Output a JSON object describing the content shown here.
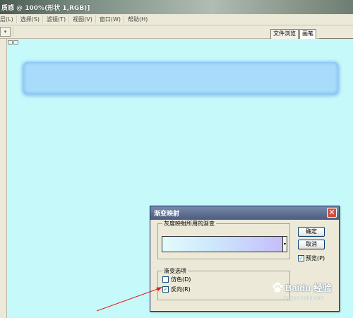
{
  "window": {
    "title": "质感 @ 100%(形状 1,RGB)]"
  },
  "menu": {
    "items": [
      "层(L)",
      "选择(S)",
      "滤镜(T)",
      "视图(V)",
      "窗口(W)",
      "帮助(H)"
    ]
  },
  "panel_tabs": [
    "文件浏览",
    "画笔"
  ],
  "dialog": {
    "title": "渐变映射",
    "group_gradient_label": "灰度映射所用的渐变",
    "ok_label": "确定",
    "cancel_label": "取消",
    "preview_label": "预览(P)",
    "preview_checked": true,
    "group_options_label": "渐变选项",
    "dither_label": "仿色(D)",
    "dither_checked": false,
    "reverse_label": "反向(R)",
    "reverse_checked": true,
    "close_glyph": "✕"
  },
  "colors": {
    "canvas": "#c6fafa",
    "shape_fill": "#a8dcfa",
    "dialog_title": "#5e6f92",
    "annotation_arrow": "#e02020"
  },
  "watermark": {
    "text": "Baidu 经验",
    "sub": "jingyan.baidu.com"
  }
}
